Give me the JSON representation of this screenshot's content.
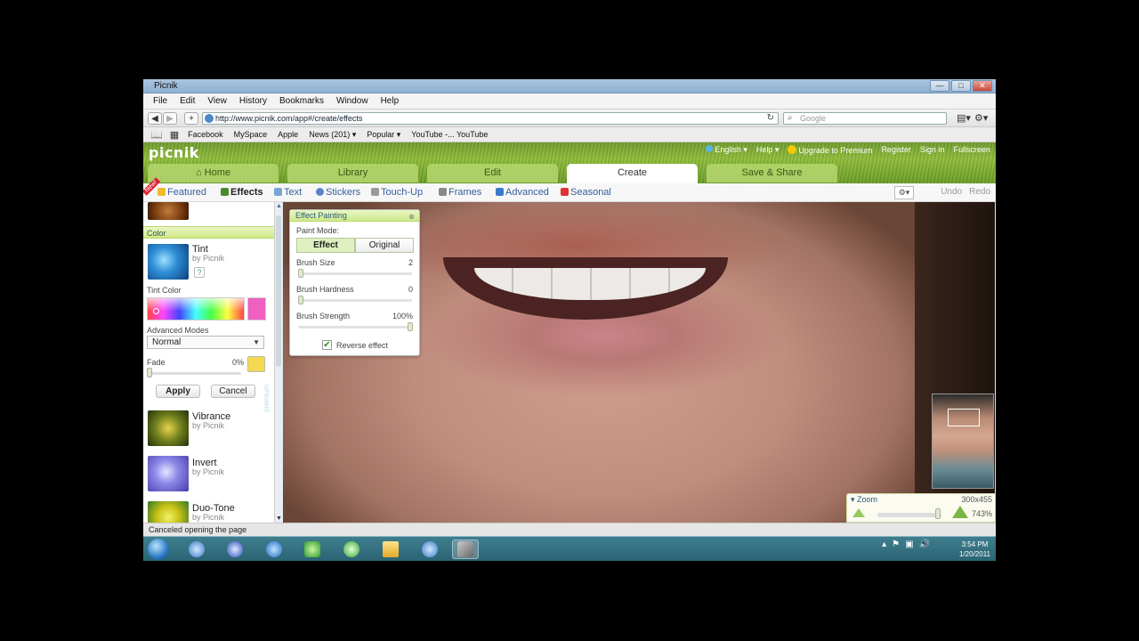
{
  "window": {
    "title": "Picnik",
    "controls": [
      "minimize",
      "maximize",
      "close"
    ]
  },
  "menu": [
    "File",
    "Edit",
    "View",
    "History",
    "Bookmarks",
    "Window",
    "Help"
  ],
  "nav": {
    "url": "http://www.picnik.com/app#/create/effects",
    "search_placeholder": "Google"
  },
  "bookmarks": [
    "Facebook",
    "MySpace",
    "Apple",
    "News (201) ▾",
    "Popular ▾",
    "YouTube -... YouTube"
  ],
  "header": {
    "logo": "picnik",
    "links": {
      "language": "English ▾",
      "help": "Help ▾",
      "upgrade": "Upgrade to Premium",
      "register": "Register",
      "signin": "Sign in",
      "fullscreen": "Fullscreen"
    },
    "tabs": [
      "Home",
      "Library",
      "Edit",
      "Create",
      "Save & Share"
    ],
    "active_tab": "Create"
  },
  "subtabs": {
    "new_flag": "New!",
    "items": [
      "Featured",
      "Effects",
      "Text",
      "Stickers",
      "Touch-Up",
      "Frames",
      "Advanced",
      "Seasonal"
    ],
    "active": "Effects",
    "undo": "Undo",
    "redo": "Redo"
  },
  "leftpanel": {
    "section": "Color",
    "effect": {
      "name": "Tint",
      "by": "by Picnik",
      "help": "?"
    },
    "tint_color_label": "Tint Color",
    "tint_color": "#f060c0",
    "advanced_modes_label": "Advanced Modes",
    "mode": "Normal",
    "fade_label": "Fade",
    "fade_value": "0%",
    "apply": "Apply",
    "cancel": "Cancel",
    "premium": "premium",
    "more_effects": [
      {
        "name": "Vibrance",
        "by": "by Picnik"
      },
      {
        "name": "Invert",
        "by": "by Picnik"
      },
      {
        "name": "Duo-Tone",
        "by": "by Picnik"
      }
    ]
  },
  "effect_painting": {
    "title": "Effect Painting",
    "paint_mode_label": "Paint Mode:",
    "modes": [
      "Effect",
      "Original"
    ],
    "active_mode": "Effect",
    "brush_size_label": "Brush Size",
    "brush_size": "2",
    "brush_hardness_label": "Brush Hardness",
    "brush_hardness": "0",
    "brush_strength_label": "Brush Strength",
    "brush_strength": "100%",
    "reverse_label": "Reverse effect",
    "reverse_checked": true
  },
  "zoom": {
    "label": "Zoom",
    "dimensions": "300x455",
    "percent": "743%"
  },
  "status": "Canceled opening the page",
  "clock": {
    "time": "3:54 PM",
    "date": "1/20/2011"
  }
}
